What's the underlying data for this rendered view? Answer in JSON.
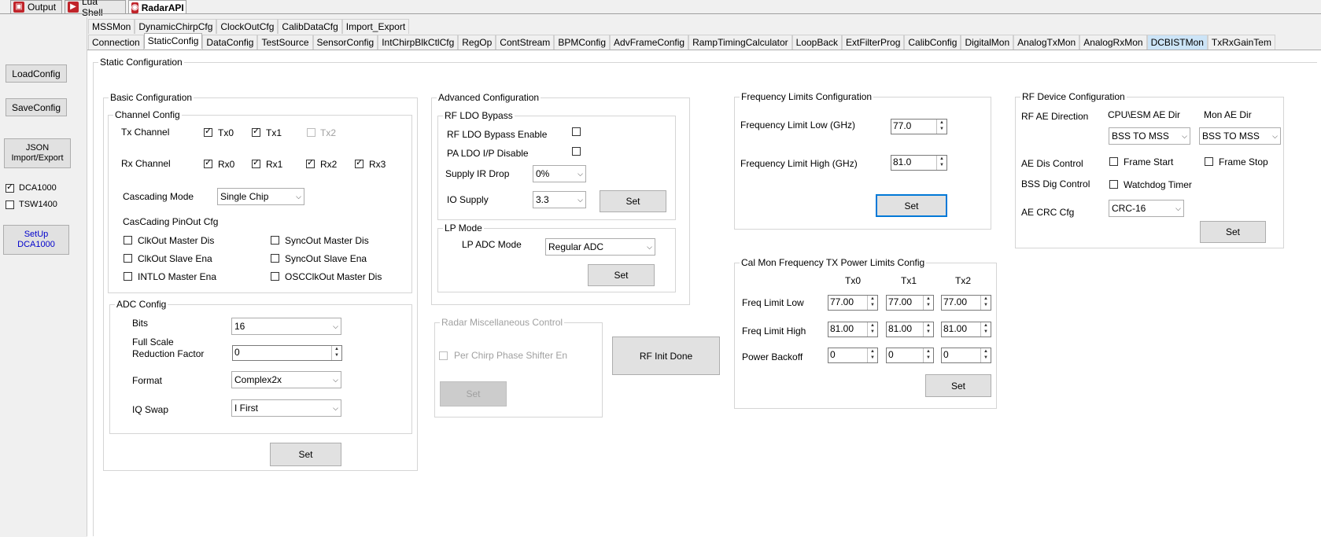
{
  "doc_tabs": [
    {
      "label": "Output",
      "icon": "output-icon"
    },
    {
      "label": "Lua Shell",
      "icon": "lua-shell-icon"
    },
    {
      "label": "RadarAPI",
      "icon": "radar-icon"
    }
  ],
  "sidebar": {
    "load_config": "LoadConfig",
    "save_config": "SaveConfig",
    "json_line1": "JSON",
    "json_line2": "Import/Export",
    "dca1000": "DCA1000",
    "tsw1400": "TSW1400",
    "setup_line1": "SetUp",
    "setup_line2": "DCA1000"
  },
  "tabs_row1": [
    "MSSMon",
    "DynamicChirpCfg",
    "ClockOutCfg",
    "CalibDataCfg",
    "Import_Export"
  ],
  "tabs_row2": [
    "Connection",
    "StaticConfig",
    "DataConfig",
    "TestSource",
    "SensorConfig",
    "IntChirpBlkCtlCfg",
    "RegOp",
    "ContStream",
    "BPMConfig",
    "AdvFrameConfig",
    "RampTimingCalculator",
    "LoopBack",
    "ExtFilterProg",
    "CalibConfig",
    "DigitalMon",
    "AnalogTxMon",
    "AnalogRxMon",
    "DCBISTMon",
    "TxRxGainTem"
  ],
  "static_title": "Static Configuration",
  "basic": {
    "title": "Basic Configuration",
    "channel_config": "Channel Config",
    "tx_channel": "Tx Channel",
    "tx": [
      "Tx0",
      "Tx1",
      "Tx2"
    ],
    "rx_channel": "Rx Channel",
    "rx": [
      "Rx0",
      "Rx1",
      "Rx2",
      "Rx3"
    ],
    "cascading_mode": "Cascading Mode",
    "cascading_value": "Single Chip",
    "pinout_title": "CasCading PinOut Cfg",
    "pinout": [
      "ClkOut Master Dis",
      "SyncOut Master Dis",
      "ClkOut Slave Ena",
      "SyncOut Slave Ena",
      "INTLO Master Ena",
      "OSCClkOut Master Dis"
    ],
    "adc_config": "ADC Config",
    "bits_label": "Bits",
    "bits_value": "16",
    "fs_label1": "Full Scale",
    "fs_label2": "Reduction Factor",
    "fs_value": "0",
    "format_label": "Format",
    "format_value": "Complex2x",
    "iq_label": "IQ Swap",
    "iq_value": "I First",
    "set": "Set"
  },
  "advanced": {
    "title": "Advanced Configuration",
    "rf_ldo": "RF LDO Bypass",
    "rf_ldo_enable": "RF LDO Bypass Enable",
    "pa_ldo": "PA LDO I/P Disable",
    "supply_ir": "Supply IR Drop",
    "supply_ir_value": "0%",
    "io_supply": "IO Supply",
    "io_supply_value": "3.3",
    "set": "Set",
    "lp_mode": "LP Mode",
    "lp_adc": "LP ADC Mode",
    "lp_adc_value": "Regular ADC"
  },
  "misc": {
    "title": "Radar Miscellaneous Control",
    "phase": "Per Chirp Phase Shifter En",
    "set": "Set",
    "rf_init": "RF Init Done"
  },
  "freq": {
    "title": "Frequency Limits Configuration",
    "low_label": "Frequency Limit Low (GHz)",
    "low_value": "77.0",
    "high_label": "Frequency Limit High (GHz)",
    "high_value": "81.0",
    "set": "Set"
  },
  "calmon": {
    "title": "Cal Mon Frequency TX Power Limits Config",
    "cols": [
      "Tx0",
      "Tx1",
      "Tx2"
    ],
    "row_low": "Freq Limit Low",
    "low": [
      "77.00",
      "77.00",
      "77.00"
    ],
    "row_high": "Freq Limit High",
    "high": [
      "81.00",
      "81.00",
      "81.00"
    ],
    "row_power": "Power Backoff",
    "power": [
      "0",
      "0",
      "0"
    ],
    "set": "Set"
  },
  "rfdev": {
    "title": "RF Device Configuration",
    "ae_dir": "RF AE Direction",
    "cpu_dir": "CPU\\ESM AE Dir",
    "mon_dir": "Mon AE Dir",
    "cpu_value": "BSS TO MSS",
    "mon_value": "BSS TO MSS",
    "ae_dis": "AE Dis Control",
    "frame_start": "Frame Start",
    "frame_stop": "Frame Stop",
    "bss_dig": "BSS Dig Control",
    "watchdog": "Watchdog Timer",
    "crc_label": "AE CRC Cfg",
    "crc_value": "CRC-16",
    "set": "Set"
  }
}
